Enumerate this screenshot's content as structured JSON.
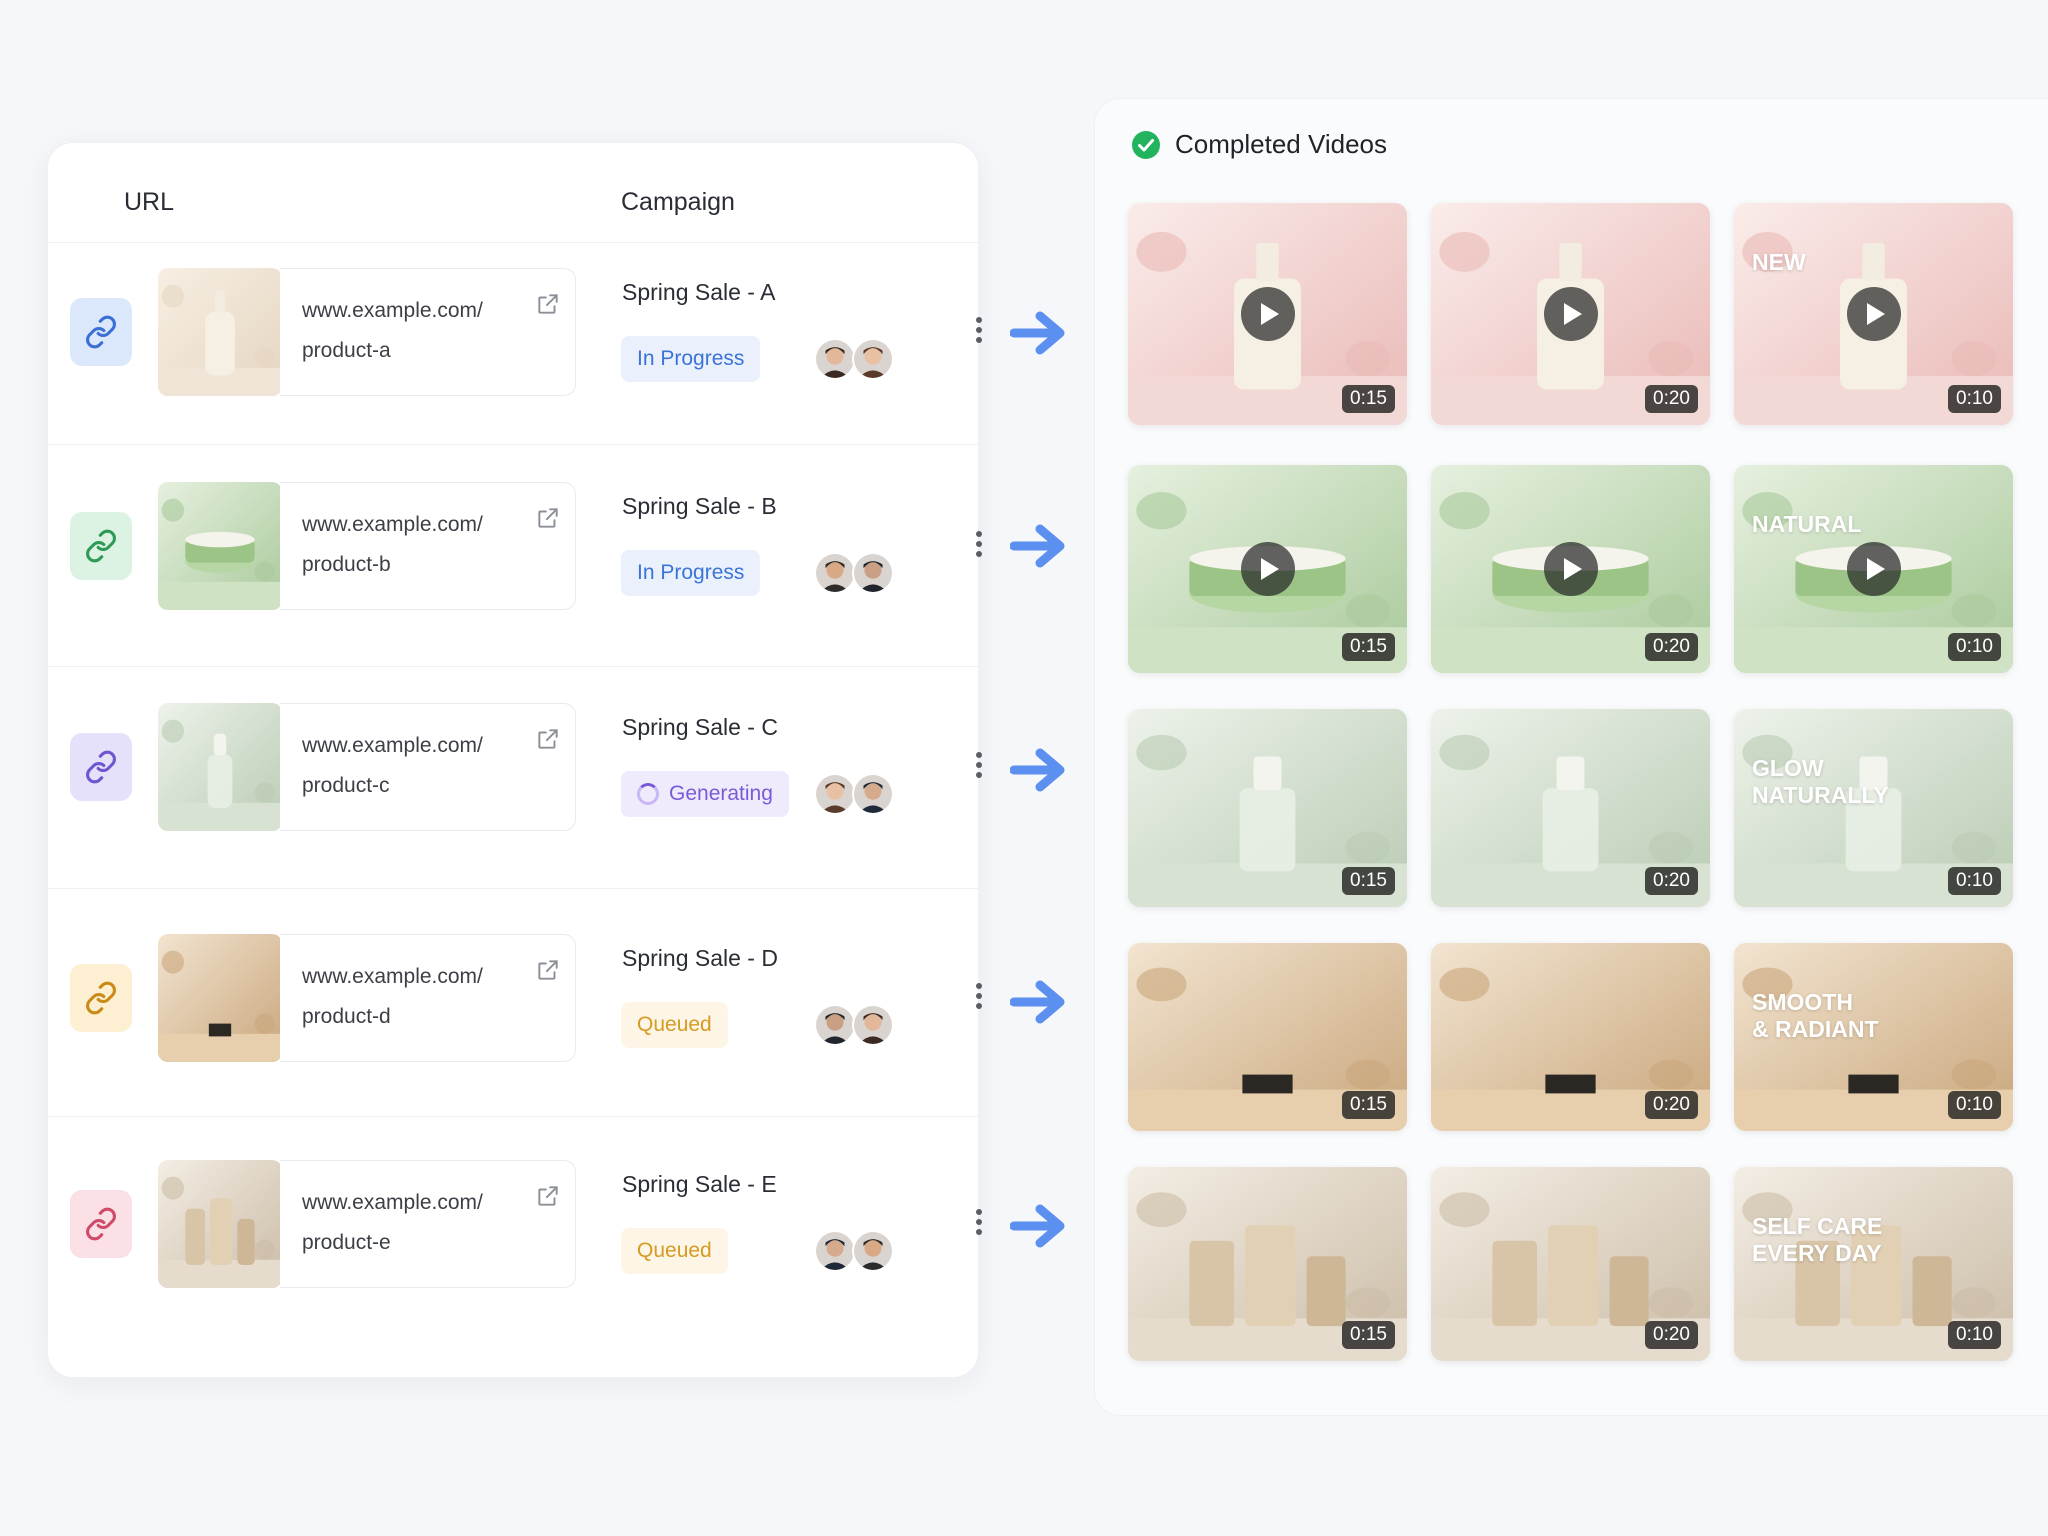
{
  "table": {
    "headers": {
      "url": "URL",
      "campaign": "Campaign"
    },
    "rows": [
      {
        "url_line1": "www.example.com/",
        "url_line2": "product-a",
        "campaign": "Spring Sale - A",
        "status": "In Progress",
        "status_type": "progress",
        "theme": "cream",
        "badge_color": "#dbe7fb",
        "badge_icon_color": "#3b6fd6"
      },
      {
        "url_line1": "www.example.com/",
        "url_line2": "product-b",
        "campaign": "Spring Sale - B",
        "status": "In Progress",
        "status_type": "progress",
        "theme": "green",
        "badge_color": "#dcf3e4",
        "badge_icon_color": "#2f9a57"
      },
      {
        "url_line1": "www.example.com/",
        "url_line2": "product-c",
        "campaign": "Spring Sale - C",
        "status": "Generating",
        "status_type": "generating",
        "theme": "sage",
        "badge_color": "#e6e1fb",
        "badge_icon_color": "#6f55cf"
      },
      {
        "url_line1": "www.example.com/",
        "url_line2": "product-d",
        "campaign": "Spring Sale - D",
        "status": "Queued",
        "status_type": "queued",
        "theme": "tan",
        "badge_color": "#fcefd2",
        "badge_icon_color": "#c98a16"
      },
      {
        "url_line1": "www.example.com/",
        "url_line2": "product-e",
        "campaign": "Spring Sale - E",
        "status": "Queued",
        "status_type": "queued",
        "theme": "beige",
        "badge_color": "#fbe0e6",
        "badge_icon_color": "#d04a6a"
      }
    ]
  },
  "videos": {
    "title": "Completed Videos",
    "rows": [
      {
        "theme": "pink",
        "tiles": [
          {
            "duration": "0:15",
            "overlay": "",
            "play": true
          },
          {
            "duration": "0:20",
            "overlay": "",
            "play": true
          },
          {
            "duration": "0:10",
            "overlay": "NEW",
            "play": true
          }
        ]
      },
      {
        "theme": "green",
        "tiles": [
          {
            "duration": "0:15",
            "overlay": "",
            "play": true
          },
          {
            "duration": "0:20",
            "overlay": "",
            "play": true
          },
          {
            "duration": "0:10",
            "overlay": "NATURAL",
            "play": true
          }
        ]
      },
      {
        "theme": "sage",
        "tiles": [
          {
            "duration": "0:15",
            "overlay": "",
            "play": false
          },
          {
            "duration": "0:20",
            "overlay": "",
            "play": false
          },
          {
            "duration": "0:10",
            "overlay": "GLOW\nNATURALLY",
            "play": false
          }
        ]
      },
      {
        "theme": "tan",
        "tiles": [
          {
            "duration": "0:15",
            "overlay": "",
            "play": false
          },
          {
            "duration": "0:20",
            "overlay": "",
            "play": false
          },
          {
            "duration": "0:10",
            "overlay": "SMOOTH\n& RADIANT",
            "play": false
          }
        ]
      },
      {
        "theme": "beige",
        "tiles": [
          {
            "duration": "0:15",
            "overlay": "",
            "play": false
          },
          {
            "duration": "0:20",
            "overlay": "",
            "play": false
          },
          {
            "duration": "0:10",
            "overlay": "SELF CARE\nEVERY DAY",
            "play": false
          }
        ]
      }
    ]
  },
  "colors": {
    "arrow": "#5b8ff0",
    "check": "#22b35e"
  }
}
